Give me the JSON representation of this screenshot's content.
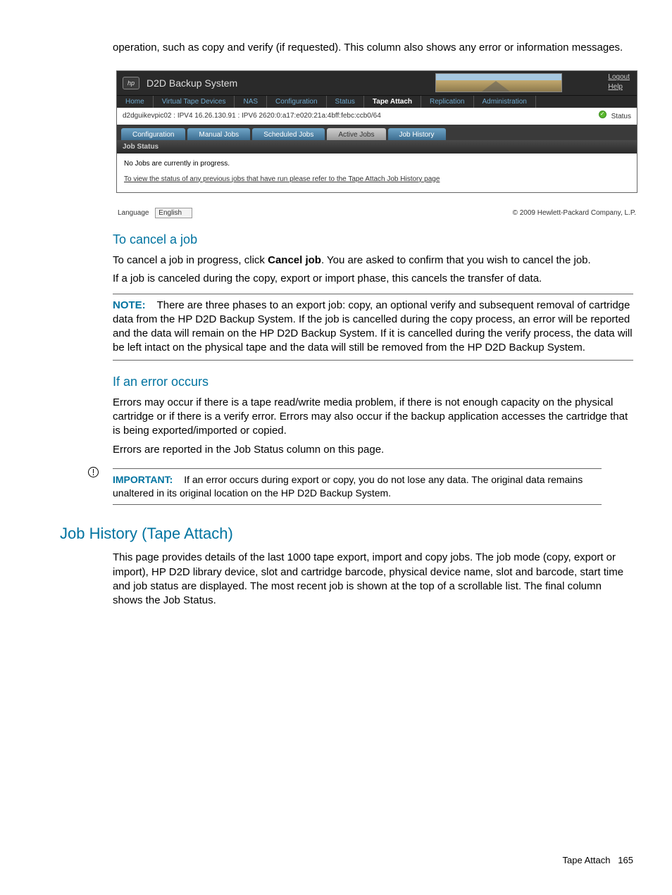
{
  "intro_para": "operation, such as copy and verify (if requested). This column also shows any error or information messages.",
  "screenshot": {
    "title": "D2D Backup System",
    "logo_text": "hp",
    "links": {
      "logout": "Logout",
      "help": "Help"
    },
    "main_nav": [
      "Home",
      "Virtual Tape Devices",
      "NAS",
      "Configuration",
      "Status",
      "Tape Attach",
      "Replication",
      "Administration"
    ],
    "main_nav_active": "Tape Attach",
    "addr": "d2dguikevpic02 : IPV4 16.26.130.91 : IPV6 2620:0:a17:e020:21a:4bff:febc:ccb0/64",
    "status_label": "Status",
    "sub_tabs": [
      "Configuration",
      "Manual Jobs",
      "Scheduled Jobs",
      "Active Jobs",
      "Job History"
    ],
    "sub_tab_selected": "Active Jobs",
    "panel_title": "Job Status",
    "no_jobs": "No Jobs are currently in progress.",
    "history_link": "To view the status of any previous jobs that have run please refer to the Tape Attach Job History page",
    "lang_label": "Language",
    "lang_value": "English",
    "copyright": "© 2009 Hewlett-Packard Company, L.P."
  },
  "sec_cancel": {
    "heading": "To cancel a job",
    "p1a": "To cancel a job in progress, click ",
    "p1b": "Cancel job",
    "p1c": ". You are asked to confirm that you wish to cancel the job.",
    "p2": "If a job is canceled during the copy, export or import phase, this cancels the transfer of data.",
    "note_label": "NOTE:",
    "note_text": "There are three phases to an export job: copy, an optional verify and subsequent removal of cartridge data from the HP D2D Backup System. If the job is cancelled during the copy process, an error will be reported and the data will remain on the HP D2D Backup System. If it is cancelled during the verify process, the data will be left intact on the physical tape and the data will still be removed from the HP D2D Backup System."
  },
  "sec_error": {
    "heading": "If an error occurs",
    "p1": "Errors may occur if there is a tape read/write media problem, if there is not enough capacity on the physical cartridge or if there is a verify error. Errors may also occur if the backup application accesses the cartridge that is being exported/imported or copied.",
    "p2": "Errors are reported in the Job Status column on this page.",
    "imp_label": "IMPORTANT:",
    "imp_text": "If an error occurs during export or copy, you do not lose any data. The original data remains unaltered in its original location on the HP D2D Backup System."
  },
  "sec_history": {
    "heading": "Job History (Tape Attach)",
    "p1": "This page provides details of the last 1000 tape export, import and copy jobs. The job mode (copy, export or import), HP D2D library device, slot and cartridge barcode, physical device name, slot and barcode, start time and job status are displayed. The most recent job is shown at the top of a scrollable list. The final column shows the Job Status."
  },
  "footer": {
    "section": "Tape Attach",
    "page": "165"
  }
}
